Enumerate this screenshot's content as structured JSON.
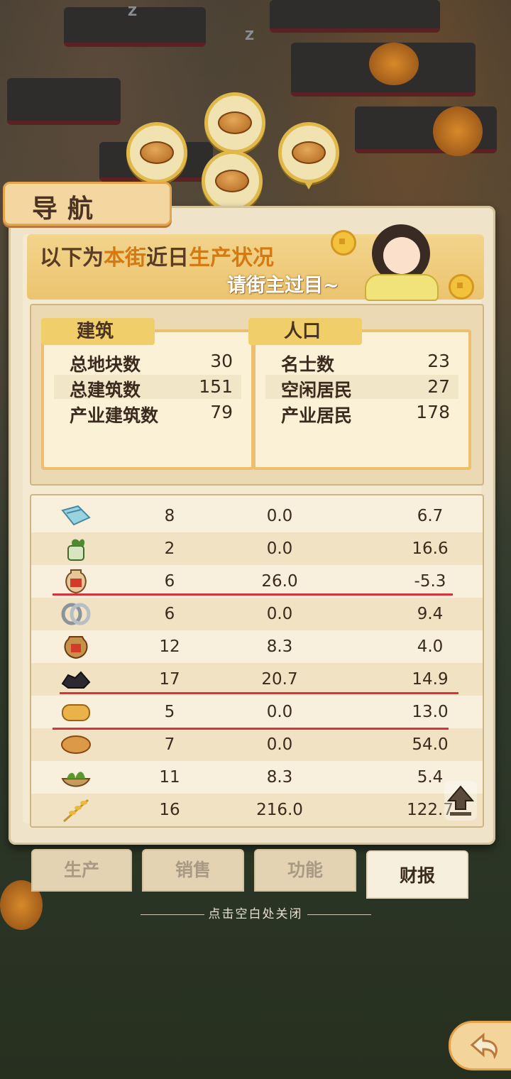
{
  "nav": {
    "title": "导航"
  },
  "banner": {
    "part1": "以下为",
    "hl1": "本街",
    "part2": "近日",
    "hl2": "生产状况",
    "line2": "请街主过目~"
  },
  "buildings": {
    "title": "建筑",
    "rows": [
      {
        "label": "总地块数",
        "value": "30"
      },
      {
        "label": "总建筑数",
        "value": "151"
      },
      {
        "label": "产业建筑数",
        "value": "79"
      }
    ]
  },
  "population": {
    "title": "人口",
    "rows": [
      {
        "label": "名士数",
        "value": "23"
      },
      {
        "label": "空闲居民",
        "value": "27"
      },
      {
        "label": "产业居民",
        "value": "178"
      }
    ]
  },
  "production": {
    "rows": [
      {
        "icon": "cloth-icon",
        "a": "8",
        "b": "0.0",
        "c": "6.7"
      },
      {
        "icon": "tea-icon",
        "a": "2",
        "b": "0.0",
        "c": "16.6"
      },
      {
        "icon": "oil-jar-icon",
        "a": "6",
        "b": "26.0",
        "c": "-5.3"
      },
      {
        "icon": "silver-rings-icon",
        "a": "6",
        "b": "0.0",
        "c": "9.4"
      },
      {
        "icon": "wine-jar-icon",
        "a": "12",
        "b": "8.3",
        "c": "4.0"
      },
      {
        "icon": "coal-icon",
        "a": "17",
        "b": "20.7",
        "c": "14.9"
      },
      {
        "icon": "pastry-icon",
        "a": "5",
        "b": "0.0",
        "c": "13.0"
      },
      {
        "icon": "bread-icon",
        "a": "7",
        "b": "0.0",
        "c": "54.0"
      },
      {
        "icon": "vegetable-icon",
        "a": "11",
        "b": "8.3",
        "c": "5.4"
      },
      {
        "icon": "wheat-icon",
        "a": "16",
        "b": "216.0",
        "c": "122.7"
      }
    ]
  },
  "tabs": [
    "生产",
    "销售",
    "功能",
    "财报"
  ],
  "active_tab": "财报",
  "close_hint": "点击空白处关闭",
  "colors": {
    "highlight": "#d57a12",
    "redline": "#d8323a",
    "accent": "#edbe6e"
  }
}
